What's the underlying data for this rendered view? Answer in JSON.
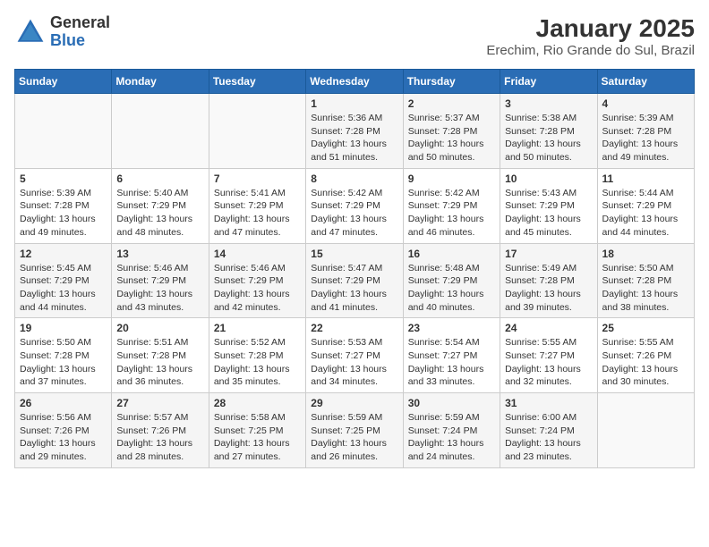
{
  "header": {
    "logo_general": "General",
    "logo_blue": "Blue",
    "title": "January 2025",
    "subtitle": "Erechim, Rio Grande do Sul, Brazil"
  },
  "weekdays": [
    "Sunday",
    "Monday",
    "Tuesday",
    "Wednesday",
    "Thursday",
    "Friday",
    "Saturday"
  ],
  "weeks": [
    [
      {
        "day": "",
        "info": ""
      },
      {
        "day": "",
        "info": ""
      },
      {
        "day": "",
        "info": ""
      },
      {
        "day": "1",
        "info": "Sunrise: 5:36 AM\nSunset: 7:28 PM\nDaylight: 13 hours\nand 51 minutes."
      },
      {
        "day": "2",
        "info": "Sunrise: 5:37 AM\nSunset: 7:28 PM\nDaylight: 13 hours\nand 50 minutes."
      },
      {
        "day": "3",
        "info": "Sunrise: 5:38 AM\nSunset: 7:28 PM\nDaylight: 13 hours\nand 50 minutes."
      },
      {
        "day": "4",
        "info": "Sunrise: 5:39 AM\nSunset: 7:28 PM\nDaylight: 13 hours\nand 49 minutes."
      }
    ],
    [
      {
        "day": "5",
        "info": "Sunrise: 5:39 AM\nSunset: 7:28 PM\nDaylight: 13 hours\nand 49 minutes."
      },
      {
        "day": "6",
        "info": "Sunrise: 5:40 AM\nSunset: 7:29 PM\nDaylight: 13 hours\nand 48 minutes."
      },
      {
        "day": "7",
        "info": "Sunrise: 5:41 AM\nSunset: 7:29 PM\nDaylight: 13 hours\nand 47 minutes."
      },
      {
        "day": "8",
        "info": "Sunrise: 5:42 AM\nSunset: 7:29 PM\nDaylight: 13 hours\nand 47 minutes."
      },
      {
        "day": "9",
        "info": "Sunrise: 5:42 AM\nSunset: 7:29 PM\nDaylight: 13 hours\nand 46 minutes."
      },
      {
        "day": "10",
        "info": "Sunrise: 5:43 AM\nSunset: 7:29 PM\nDaylight: 13 hours\nand 45 minutes."
      },
      {
        "day": "11",
        "info": "Sunrise: 5:44 AM\nSunset: 7:29 PM\nDaylight: 13 hours\nand 44 minutes."
      }
    ],
    [
      {
        "day": "12",
        "info": "Sunrise: 5:45 AM\nSunset: 7:29 PM\nDaylight: 13 hours\nand 44 minutes."
      },
      {
        "day": "13",
        "info": "Sunrise: 5:46 AM\nSunset: 7:29 PM\nDaylight: 13 hours\nand 43 minutes."
      },
      {
        "day": "14",
        "info": "Sunrise: 5:46 AM\nSunset: 7:29 PM\nDaylight: 13 hours\nand 42 minutes."
      },
      {
        "day": "15",
        "info": "Sunrise: 5:47 AM\nSunset: 7:29 PM\nDaylight: 13 hours\nand 41 minutes."
      },
      {
        "day": "16",
        "info": "Sunrise: 5:48 AM\nSunset: 7:29 PM\nDaylight: 13 hours\nand 40 minutes."
      },
      {
        "day": "17",
        "info": "Sunrise: 5:49 AM\nSunset: 7:28 PM\nDaylight: 13 hours\nand 39 minutes."
      },
      {
        "day": "18",
        "info": "Sunrise: 5:50 AM\nSunset: 7:28 PM\nDaylight: 13 hours\nand 38 minutes."
      }
    ],
    [
      {
        "day": "19",
        "info": "Sunrise: 5:50 AM\nSunset: 7:28 PM\nDaylight: 13 hours\nand 37 minutes."
      },
      {
        "day": "20",
        "info": "Sunrise: 5:51 AM\nSunset: 7:28 PM\nDaylight: 13 hours\nand 36 minutes."
      },
      {
        "day": "21",
        "info": "Sunrise: 5:52 AM\nSunset: 7:28 PM\nDaylight: 13 hours\nand 35 minutes."
      },
      {
        "day": "22",
        "info": "Sunrise: 5:53 AM\nSunset: 7:27 PM\nDaylight: 13 hours\nand 34 minutes."
      },
      {
        "day": "23",
        "info": "Sunrise: 5:54 AM\nSunset: 7:27 PM\nDaylight: 13 hours\nand 33 minutes."
      },
      {
        "day": "24",
        "info": "Sunrise: 5:55 AM\nSunset: 7:27 PM\nDaylight: 13 hours\nand 32 minutes."
      },
      {
        "day": "25",
        "info": "Sunrise: 5:55 AM\nSunset: 7:26 PM\nDaylight: 13 hours\nand 30 minutes."
      }
    ],
    [
      {
        "day": "26",
        "info": "Sunrise: 5:56 AM\nSunset: 7:26 PM\nDaylight: 13 hours\nand 29 minutes."
      },
      {
        "day": "27",
        "info": "Sunrise: 5:57 AM\nSunset: 7:26 PM\nDaylight: 13 hours\nand 28 minutes."
      },
      {
        "day": "28",
        "info": "Sunrise: 5:58 AM\nSunset: 7:25 PM\nDaylight: 13 hours\nand 27 minutes."
      },
      {
        "day": "29",
        "info": "Sunrise: 5:59 AM\nSunset: 7:25 PM\nDaylight: 13 hours\nand 26 minutes."
      },
      {
        "day": "30",
        "info": "Sunrise: 5:59 AM\nSunset: 7:24 PM\nDaylight: 13 hours\nand 24 minutes."
      },
      {
        "day": "31",
        "info": "Sunrise: 6:00 AM\nSunset: 7:24 PM\nDaylight: 13 hours\nand 23 minutes."
      },
      {
        "day": "",
        "info": ""
      }
    ]
  ]
}
